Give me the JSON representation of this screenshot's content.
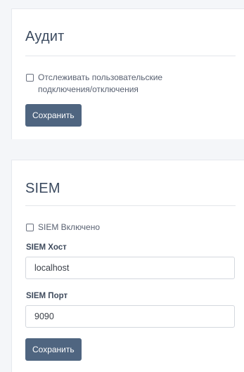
{
  "audit": {
    "title": "Аудит",
    "checkbox_label": "Отслеживать пользовательские подключения/отключения",
    "checkbox_checked": false,
    "save_label": "Сохранить"
  },
  "siem": {
    "title": "SIEM",
    "enabled_label": "SIEM Включено",
    "enabled_checked": false,
    "host_label": "SIEM Хост",
    "host_value": "localhost",
    "port_label": "SIEM Порт",
    "port_value": "9090",
    "save_label": "Сохранить"
  },
  "colors": {
    "button_bg": "#4f6580",
    "page_bg": "#f4f6f9",
    "card_bg": "#ffffff"
  }
}
